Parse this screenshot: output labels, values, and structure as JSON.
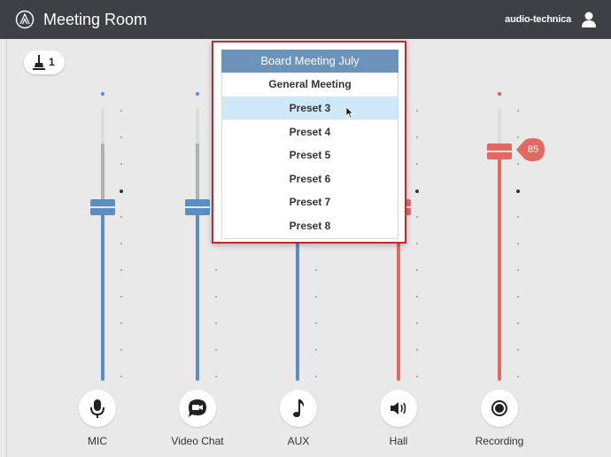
{
  "app": {
    "title": "Meeting Room",
    "brand": "audio-technica"
  },
  "chair": {
    "label": "1"
  },
  "channels": [
    {
      "name": "MIC",
      "color": "#5b8fc3",
      "icon": "microphone-icon"
    },
    {
      "name": "Video Chat",
      "color": "#5b8fc3",
      "icon": "video-chat-icon"
    },
    {
      "name": "AUX",
      "color": "#5b8fc3",
      "icon": "music-note-icon"
    },
    {
      "name": "Hall",
      "color": "#e06a62",
      "icon": "speaker-icon"
    },
    {
      "name": "Recording",
      "color": "#e06a62",
      "icon": "record-icon",
      "level": "85"
    }
  ],
  "presets": {
    "selected": "Board Meeting July",
    "items": [
      "General Meeting",
      "Preset 3",
      "Preset 4",
      "Preset 5",
      "Preset 6",
      "Preset 7",
      "Preset 8"
    ],
    "highlighted": "Preset 3"
  },
  "colors": {
    "accent_blue": "#5b8fc3",
    "accent_red": "#e06a62",
    "dropdown_border": "#c9252c",
    "header": "#6c93b9"
  }
}
